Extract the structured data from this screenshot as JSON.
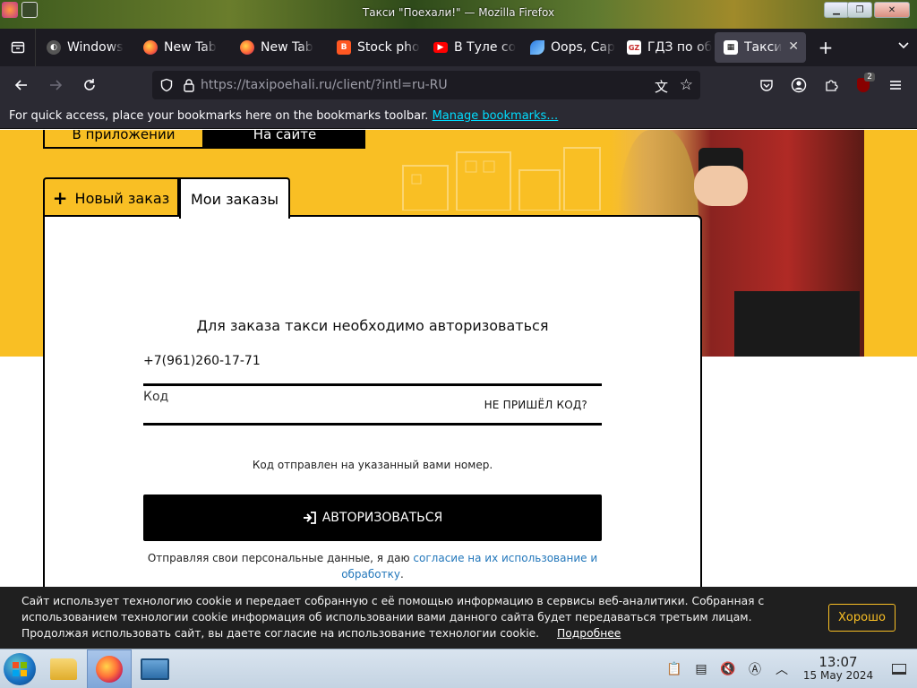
{
  "window": {
    "title": "Такси \"Поехали!\" — Mozilla Firefox",
    "buttons": [
      "minimize",
      "maximize",
      "close"
    ]
  },
  "tabs": [
    {
      "label": "Windows",
      "icon": "windows-favicon"
    },
    {
      "label": "New Tab",
      "icon": "firefox-icon"
    },
    {
      "label": "New Tab",
      "icon": "firefox-icon"
    },
    {
      "label": "Stock pho",
      "icon": "blogger-icon"
    },
    {
      "label": "В Туле со",
      "icon": "youtube-icon"
    },
    {
      "label": "Oops, Сар",
      "icon": "feather-icon"
    },
    {
      "label": "ГДЗ по об",
      "icon": "gdz-icon"
    },
    {
      "label": "Такси",
      "icon": "taxi-icon",
      "active": true
    }
  ],
  "nav": {
    "url_main": "https://taxipoehali.ru",
    "url_path": "/client/?intl=ru-RU",
    "extensions_badge": "2"
  },
  "bookmarks_bar": {
    "text": "For quick access, place your bookmarks here on the bookmarks toolbar.",
    "link": "Manage bookmarks…"
  },
  "page": {
    "top_button_app": "В приложении",
    "top_button_site": "На сайте",
    "tab_new_order": "Новый заказ",
    "tab_my_orders": "Мои заказы",
    "heading": "Для заказа такси необходимо авторизоваться",
    "phone_value": "+7(961)260-17-71",
    "code_placeholder": "Код",
    "no_code_link": "НЕ ПРИШЁЛ КОД?",
    "code_sent": "Код отправлен на указанный вами номер.",
    "auth_button": "АВТОРИЗОВАТЬСЯ",
    "consent_text": "Отправляя свои персональные данные, я даю",
    "consent_link": "согласие на их использование и обработку",
    "consent_end": "."
  },
  "cookie": {
    "text": "Сайт использует технологию cookie и передает собранную с её помощью информацию в сервисы веб-аналитики. Собранная с использованием технологии cookie информация об использовании вами данного сайта будет передаваться третьим лицам. Продолжая использовать сайт, вы даете согласие на использование технологии cookie.",
    "more": "Подробнее",
    "ok": "Хорошо"
  },
  "taskbar": {
    "apps": [
      "file-manager-icon",
      "firefox-icon",
      "terminal-icon"
    ],
    "time": "13:07",
    "date": "15 May 2024"
  },
  "colors": {
    "accent": "#f9bf24",
    "link": "#2277bb",
    "browser_dark": "#1c1b22"
  }
}
